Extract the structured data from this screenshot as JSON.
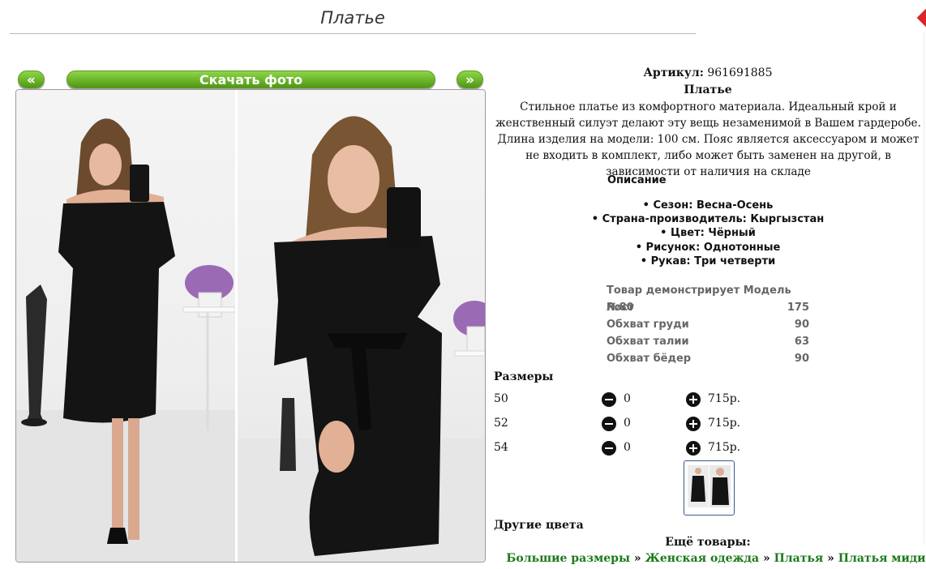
{
  "page_title": "Платье",
  "gallery": {
    "prev_label": "«",
    "download_label": "Скачать фото",
    "next_label": "»"
  },
  "product": {
    "sku_label": "Артикул:",
    "sku_value": "961691885",
    "name": "Платье",
    "description": "Стильное платье из комфортного материала. Идеальный крой и женственный силуэт делают эту вещь незаменимой в Вашем гардеробе. Длина изделия на модели: 100 см. Пояс является аксессуаром и может не входить в комплект, либо может быть заменен на другой, в зависимости от наличия на складе",
    "description_heading": "Описание",
    "specs": [
      "Сезон: Весна-Осень",
      "Страна-производитель: Кыргызстан",
      "Цвет: Чёрный",
      "Рисунок: Однотонные",
      "Рукав: Три четверти"
    ]
  },
  "model": {
    "heading": "Товар демонстрирует Модель №80",
    "rows": [
      {
        "label": "Рост",
        "value": "175"
      },
      {
        "label": "Обхват груди",
        "value": "90"
      },
      {
        "label": "Обхват талии",
        "value": "63"
      },
      {
        "label": "Обхват бёдер",
        "value": "90"
      }
    ]
  },
  "sizes": {
    "heading": "Размеры",
    "rows": [
      {
        "size": "50",
        "qty": "0",
        "price": "715р."
      },
      {
        "size": "52",
        "qty": "0",
        "price": "715р."
      },
      {
        "size": "54",
        "qty": "0",
        "price": "715р."
      }
    ]
  },
  "other_colors_heading": "Другие цвета",
  "more_items": {
    "heading": "Ещё товары:",
    "links": [
      "Большие размеры",
      "Женская одежда",
      "Платья",
      "Платья миди"
    ],
    "separator": "»"
  },
  "colors": {
    "button_green": "#6bb52a",
    "link_green": "#1a7a1a",
    "dress": "#141414",
    "sku_icon_red": "#d9262a"
  }
}
